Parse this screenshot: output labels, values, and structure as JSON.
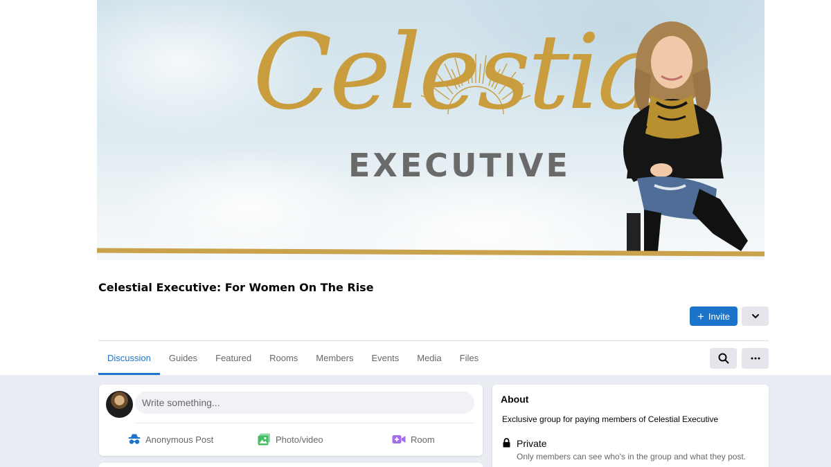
{
  "cover": {
    "brand_script": "Celestial",
    "brand_word": "EXECUTIVE",
    "accent_color": "#c99d3e"
  },
  "group": {
    "title": "Celestial Executive: For Women On The Rise"
  },
  "actions": {
    "invite_label": "Invite",
    "invite_icon": "plus-icon",
    "more_icon": "chevron-down-icon",
    "primary_color": "#1b74c9"
  },
  "tabs": [
    {
      "label": "Discussion",
      "active": true
    },
    {
      "label": "Guides"
    },
    {
      "label": "Featured"
    },
    {
      "label": "Rooms"
    },
    {
      "label": "Members"
    },
    {
      "label": "Events"
    },
    {
      "label": "Media"
    },
    {
      "label": "Files"
    }
  ],
  "composer": {
    "placeholder": "Write something...",
    "actions": [
      {
        "label": "Anonymous Post",
        "icon": "incognito-icon",
        "color": "#1b74c9"
      },
      {
        "label": "Photo/video",
        "icon": "photo-icon",
        "color": "#45bd62"
      },
      {
        "label": "Room",
        "icon": "video-camera-plus-icon",
        "color": "#a36ee8"
      }
    ]
  },
  "about": {
    "title": "About",
    "description": "Exclusive group for paying members of Celestial Executive",
    "privacy_label": "Private",
    "privacy_description": "Only members can see who's in the group and what they post."
  }
}
